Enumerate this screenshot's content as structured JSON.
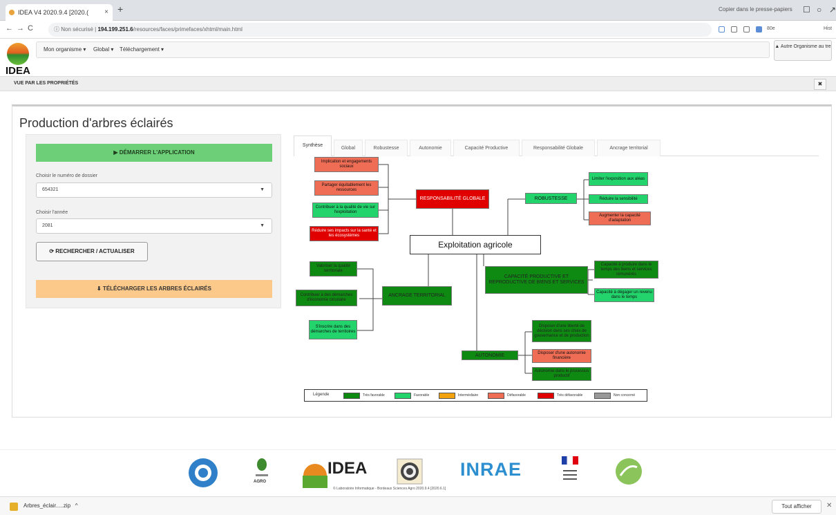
{
  "browser": {
    "tab_title": "IDEA V4 2020.9.4 [2020.(",
    "tab_close": "×",
    "new_tab": "+",
    "clipboard_text": "Copier dans le presse-papiers",
    "insecure_label": "Non sécurisé",
    "url_host": "194.199.251.6",
    "url_path": "/resources/faces/primefaces/xhtml/main.html",
    "ext_label": "80e",
    "ext_label2": "Hist"
  },
  "app": {
    "logo_text": "IDEA",
    "menu": [
      "Mon organisme ▾",
      "Global ▾",
      "Téléchargement ▾"
    ],
    "org_button": "Autre Organisme au tre",
    "section_title": "VUE PAR LES PROPRIÉTÉS",
    "section_close": "✖"
  },
  "page": {
    "title": "Production d'arbres éclairés",
    "start_button": "▶ DÉMARRER L'APPLICATION",
    "dossier_label": "Choisir le numéro de dossier",
    "dossier_value": "654321",
    "year_label": "Choisir l'année",
    "year_value": "2081",
    "search_button": "⟳ RECHERCHER / ACTUALISER",
    "download_button": "⬇ TÉLÉCHARGER LES ARBRES ÉCLAIRÉS"
  },
  "tabs": [
    "Synthèse",
    "Global",
    "Robustesse",
    "Autonomie",
    "Capacité Productive",
    "Responsabilité Globale",
    "Ancrage territorial"
  ],
  "tree": {
    "root": "Exploitation agricole",
    "resp": "RESPONSABILITÉ GLOBALE",
    "resp_children": [
      "Implication et engagements sociaux",
      "Partager équitablement les ressources",
      "Contribuer à la qualité de vie sur l'exploitation",
      "Réduire ses impacts sur la santé et les écosystèmes"
    ],
    "robust": "ROBUSTESSE",
    "robust_children": [
      "Limiter l'exposition aux aléas",
      "Réduire la sensibilité",
      "Augmenter la capacité d'adaptation"
    ],
    "ancrage": "ANCRAGE TERRITORIAL",
    "ancrage_children": [
      "Valoriser la qualité territoriale",
      "Contribuer à des démarches d'économie circulaire",
      "S'inscrire dans des démarches de territoires"
    ],
    "capacite": "CAPACITÉ PRODUCTIVE ET REPRODUCTIVE DE BIENS ET SERVICES",
    "capacite_children": [
      "Capacité à produire dans le temps des biens et services rémunérés",
      "Capacité à dégager un revenu dans le temps"
    ],
    "autonomie": "AUTONOMIE",
    "autonomie_children": [
      "Disposer d'une liberté de décision dans ses choix de gouvernance et de production",
      "Disposer d'une autonomie financière",
      "Autonomie dans le processus productif"
    ]
  },
  "legend": {
    "title": "Légende",
    "items": [
      "Très favorable",
      "Favorable",
      "Intermédiaire",
      "Défavorable",
      "Très défavorable",
      "Non concerné"
    ],
    "colors": [
      "#0e8a12",
      "#22d46b",
      "#f2a20c",
      "#ef6c55",
      "#e00000",
      "#999999"
    ]
  },
  "footer": {
    "logo_idea": "IDEA",
    "logo_inrae": "INRAE",
    "logo_agro": "AGRO",
    "copyright": "© Laboratoire Informatique - Bordeaux Sciences Agro 2020.9.4 [2020.6.1]"
  },
  "downloads": {
    "file": "Arbres_éclair.....zip",
    "chevron": "^",
    "show_all": "Tout afficher",
    "close": "✕"
  }
}
